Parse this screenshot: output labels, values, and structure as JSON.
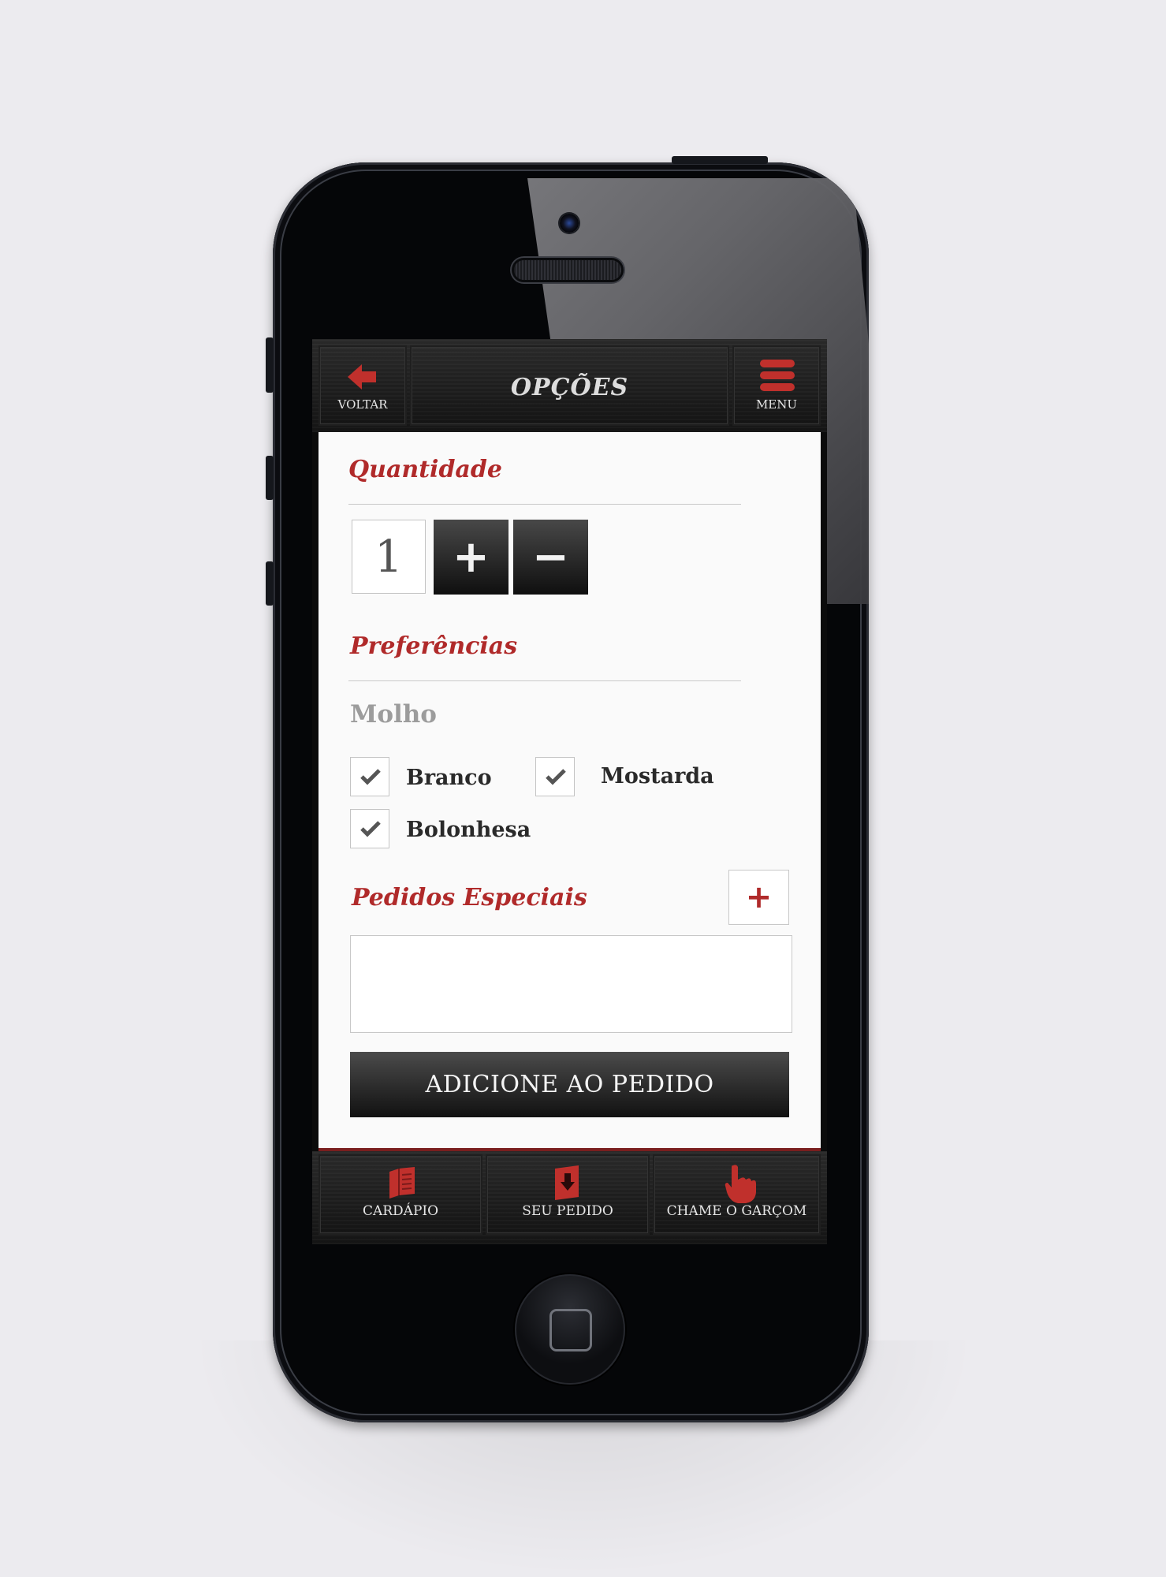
{
  "topbar": {
    "back_label": "VOLTAR",
    "title": "OPÇÕES",
    "menu_label": "MENU"
  },
  "quantity": {
    "heading": "Quantidade",
    "value": "1",
    "plus_label": "+",
    "minus_label": "−"
  },
  "preferences": {
    "heading": "Preferências",
    "group_label": "Molho",
    "options": [
      {
        "label": "Branco",
        "checked": true
      },
      {
        "label": "Mostarda",
        "checked": true
      },
      {
        "label": "Bolonhesa",
        "checked": true
      }
    ]
  },
  "special": {
    "heading": "Pedidos Especiais",
    "add_label": "+",
    "text": ""
  },
  "add_button": "ADICIONE AO PEDIDO",
  "tabbar": {
    "items": [
      {
        "label": "CARDÁPIO",
        "icon": "book-icon"
      },
      {
        "label": "SEU PEDIDO",
        "icon": "order-download-icon"
      },
      {
        "label": "CHAME O GARÇOM",
        "icon": "hand-pointer-icon"
      }
    ]
  },
  "colors": {
    "accent": "#b02a2a",
    "bar": "#1a1a1a",
    "background": "#ecebef"
  }
}
